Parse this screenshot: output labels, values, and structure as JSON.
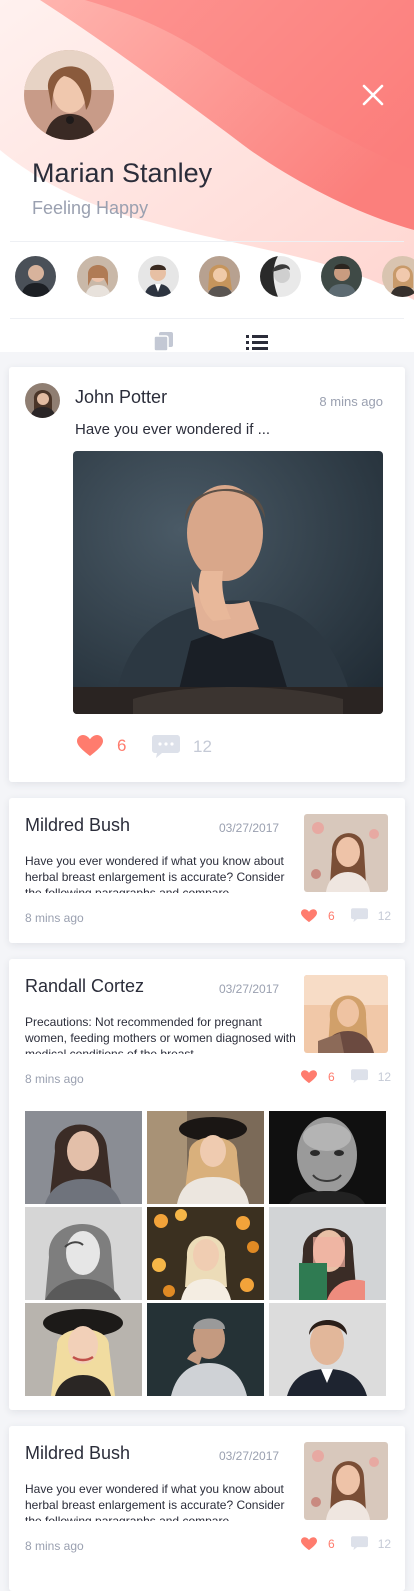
{
  "profile": {
    "name": "Marian Stanley",
    "status": "Feeling Happy"
  },
  "colors": {
    "accent": "#ff7c6e",
    "wave_light": "#ffd0cc",
    "wave_dark": "#fb7e7c",
    "muted_text": "#9aa0b0"
  },
  "icons": {
    "close": "close-icon",
    "grid_view": "grid-view-icon",
    "list_view": "list-view-icon",
    "like": "heart-icon",
    "comment": "comment-icon"
  },
  "post": {
    "author": "John Potter",
    "time": "8 mins ago",
    "text": "Have you ever wondered if ...",
    "likes": "6",
    "comments": "12"
  },
  "articles": [
    {
      "title": "Mildred Bush",
      "date": "03/27/2017",
      "body": "Have you ever wondered if what you know about herbal breast enlargement is accurate? Consider the following paragraphs and compare",
      "ago": "8 mins ago",
      "likes": "6",
      "comments": "12"
    },
    {
      "title": "Randall Cortez",
      "date": "03/27/2017",
      "body": "Precautions: Not recommended for pregnant women, feeding mothers or women diagnosed with medical conditions of the breast.",
      "ago": "8 mins ago",
      "likes": "6",
      "comments": "12"
    },
    {
      "title": "Mildred Bush",
      "date": "03/27/2017",
      "body": "Have you ever wondered if what you know about herbal breast enlargement is accurate? Consider the following paragraphs and compare",
      "ago": "8 mins ago",
      "likes": "6",
      "comments": "12"
    }
  ]
}
